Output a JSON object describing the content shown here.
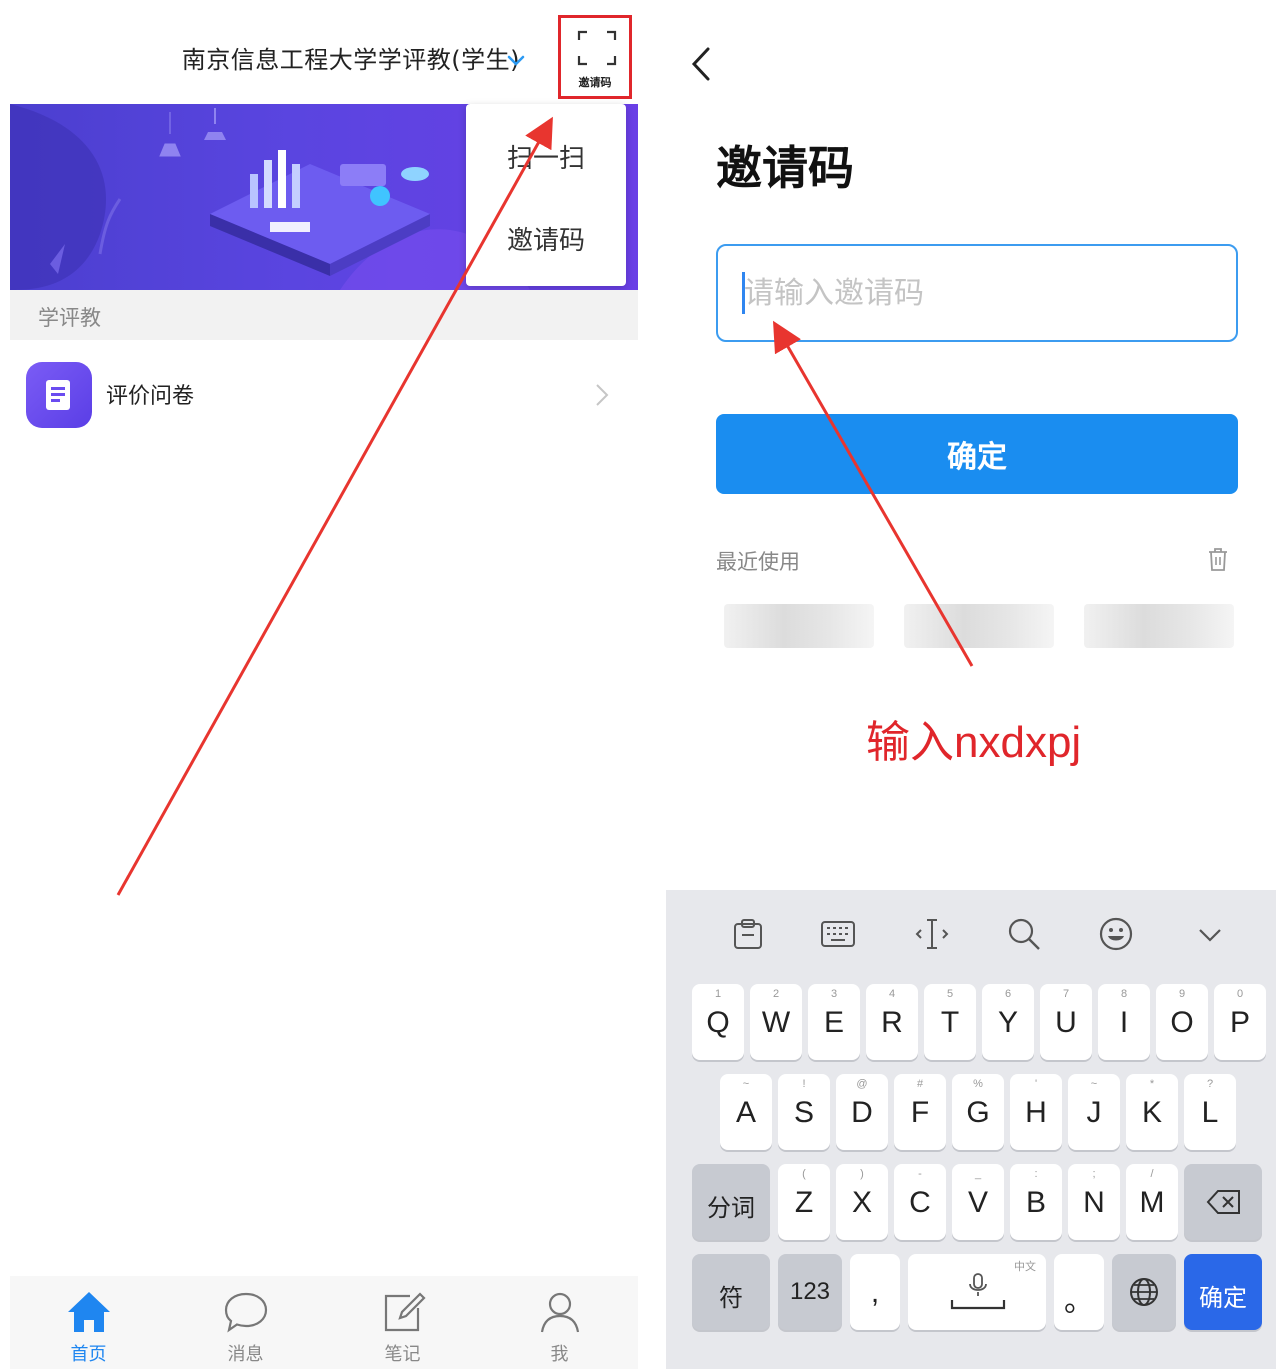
{
  "left_screen": {
    "header_title": "南京信息工程大学学评教(学生)",
    "invite_button_label": "邀请码",
    "popup_menu": [
      {
        "label": "扫一扫"
      },
      {
        "label": "邀请码"
      }
    ],
    "section_label": "学评教",
    "list_item_label": "评价问卷",
    "tabs": [
      {
        "label": "首页",
        "icon": "home-icon",
        "active": true
      },
      {
        "label": "消息",
        "icon": "message-icon",
        "active": false
      },
      {
        "label": "笔记",
        "icon": "note-icon",
        "active": false
      },
      {
        "label": "我",
        "icon": "profile-icon",
        "active": false
      }
    ]
  },
  "right_screen": {
    "title": "邀请码",
    "input_placeholder": "请输入邀请码",
    "input_value": "",
    "confirm_label": "确定",
    "recent_label": "最近使用",
    "annotation": "输入nxdxpj"
  },
  "keyboard": {
    "row1": [
      {
        "k": "Q",
        "h": "1"
      },
      {
        "k": "W",
        "h": "2"
      },
      {
        "k": "E",
        "h": "3"
      },
      {
        "k": "R",
        "h": "4"
      },
      {
        "k": "T",
        "h": "5"
      },
      {
        "k": "Y",
        "h": "6"
      },
      {
        "k": "U",
        "h": "7"
      },
      {
        "k": "I",
        "h": "8"
      },
      {
        "k": "O",
        "h": "9"
      },
      {
        "k": "P",
        "h": "0"
      }
    ],
    "row2": [
      {
        "k": "A",
        "h": "~"
      },
      {
        "k": "S",
        "h": "!"
      },
      {
        "k": "D",
        "h": "@"
      },
      {
        "k": "F",
        "h": "#"
      },
      {
        "k": "G",
        "h": "%"
      },
      {
        "k": "H",
        "h": "'"
      },
      {
        "k": "J",
        "h": "~"
      },
      {
        "k": "K",
        "h": "*"
      },
      {
        "k": "L",
        "h": "?"
      }
    ],
    "row3": [
      {
        "k": "Z",
        "h": "("
      },
      {
        "k": "X",
        "h": ")"
      },
      {
        "k": "C",
        "h": "-"
      },
      {
        "k": "V",
        "h": "_"
      },
      {
        "k": "B",
        "h": ":"
      },
      {
        "k": "N",
        "h": ";"
      },
      {
        "k": "M",
        "h": "/"
      }
    ],
    "split_label": "分词",
    "symbol_label": "符",
    "numeric_label": "123",
    "comma": ",",
    "space_hint": "中文",
    "period": "。",
    "enter_label": "确定",
    "accent_color": "#2a68e8"
  },
  "colors": {
    "primary_blue": "#1a8df0",
    "annotation_red": "#e0262b",
    "banner_purple": "#5a45e0"
  }
}
